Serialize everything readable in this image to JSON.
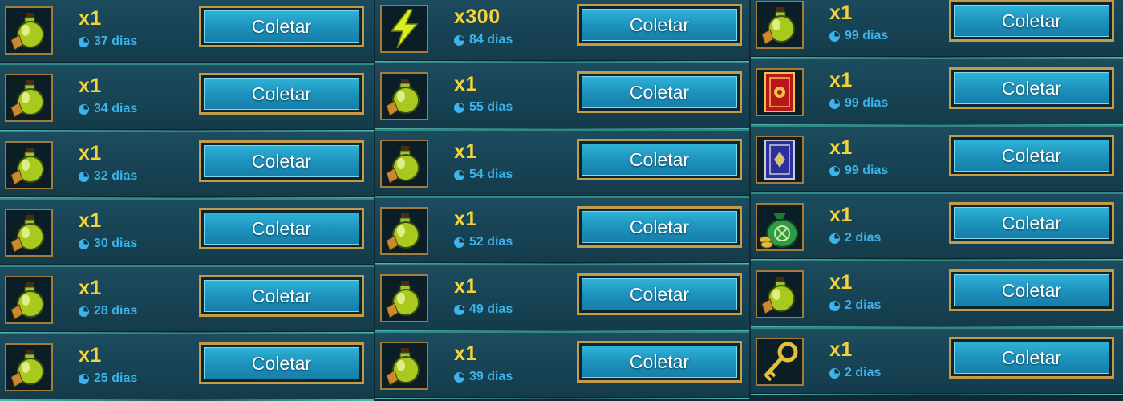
{
  "button_label": "Coletar",
  "colors": {
    "row_bg": "#174354",
    "quantity_text": "#f3d23a",
    "timer_text": "#3cb3ea",
    "button_fill": "#1d93be",
    "button_border": "#c59b48",
    "icon_frame": "#a27c3a"
  },
  "columns": [
    {
      "rewards": [
        {
          "icon": "potion-icon",
          "quantity": "x1",
          "expires": "37 dias"
        },
        {
          "icon": "potion-icon",
          "quantity": "x1",
          "expires": "34 dias"
        },
        {
          "icon": "potion-icon",
          "quantity": "x1",
          "expires": "32 dias"
        },
        {
          "icon": "potion-icon",
          "quantity": "x1",
          "expires": "30 dias"
        },
        {
          "icon": "potion-icon",
          "quantity": "x1",
          "expires": "28 dias"
        },
        {
          "icon": "potion-icon",
          "quantity": "x1",
          "expires": "25 dias"
        }
      ]
    },
    {
      "rewards": [
        {
          "icon": "energy-bolt-icon",
          "quantity": "x300",
          "expires": "84 dias"
        },
        {
          "icon": "potion-icon",
          "quantity": "x1",
          "expires": "55 dias"
        },
        {
          "icon": "potion-icon",
          "quantity": "x1",
          "expires": "54 dias"
        },
        {
          "icon": "potion-icon",
          "quantity": "x1",
          "expires": "52 dias"
        },
        {
          "icon": "potion-icon",
          "quantity": "x1",
          "expires": "49 dias"
        },
        {
          "icon": "potion-icon",
          "quantity": "x1",
          "expires": "39 dias"
        }
      ]
    },
    {
      "rewards": [
        {
          "icon": "potion-icon",
          "quantity": "x1",
          "expires": "99 dias"
        },
        {
          "icon": "red-tome-icon",
          "quantity": "x1",
          "expires": "99 dias"
        },
        {
          "icon": "blue-tome-icon",
          "quantity": "x1",
          "expires": "99 dias"
        },
        {
          "icon": "silver-bag-icon",
          "quantity": "x1",
          "expires": "2 dias"
        },
        {
          "icon": "potion-icon",
          "quantity": "x1",
          "expires": "2 dias"
        },
        {
          "icon": "gold-key-icon",
          "quantity": "x1",
          "expires": "2 dias"
        }
      ]
    }
  ]
}
